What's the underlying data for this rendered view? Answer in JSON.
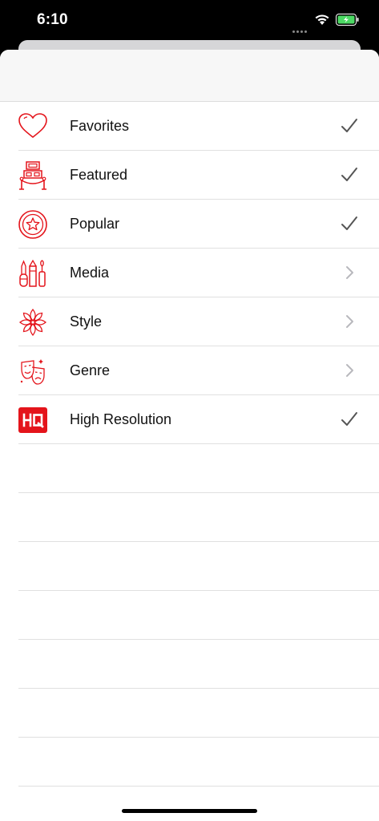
{
  "status_bar": {
    "time": "6:10",
    "battery_color": "#4cd964"
  },
  "accent_color": "#e4141b",
  "list": {
    "items": [
      {
        "label": "Favorites",
        "icon": "heart-icon",
        "accessory": "checkmark"
      },
      {
        "label": "Featured",
        "icon": "featured-stand-icon",
        "accessory": "checkmark"
      },
      {
        "label": "Popular",
        "icon": "star-badge-icon",
        "accessory": "checkmark"
      },
      {
        "label": "Media",
        "icon": "art-tools-icon",
        "accessory": "chevron"
      },
      {
        "label": "Style",
        "icon": "flower-icon",
        "accessory": "chevron"
      },
      {
        "label": "Genre",
        "icon": "theater-masks-icon",
        "accessory": "chevron"
      },
      {
        "label": "High Resolution",
        "icon": "hq-badge-icon",
        "accessory": "checkmark"
      }
    ]
  }
}
